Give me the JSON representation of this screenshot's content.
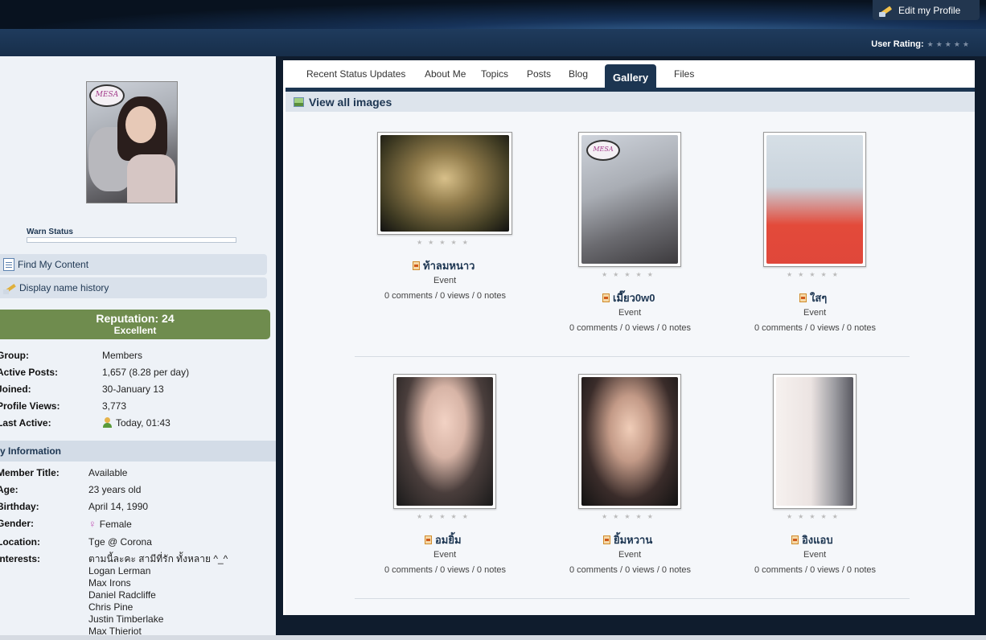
{
  "header": {
    "edit_profile_label": "Edit my Profile",
    "user_rating_label": "User Rating:",
    "rating_stars": "★★★★★"
  },
  "sidebar": {
    "avatar_tag": "MESA",
    "warn_status_label": "Warn Status",
    "links": [
      {
        "label": "Find My Content",
        "icon": "document-icon"
      },
      {
        "label": "Display name history",
        "icon": "pencil-icon"
      }
    ],
    "reputation": {
      "title": "Reputation: 24",
      "level": "Excellent"
    },
    "stats": [
      {
        "label": "Group:",
        "value": "Members"
      },
      {
        "label": "Active Posts:",
        "value": "1,657 (8.28 per day)"
      },
      {
        "label": "Joined:",
        "value": "30-January 13"
      },
      {
        "label": "Profile Views:",
        "value": "3,773"
      },
      {
        "label": "Last Active:",
        "value": "Today, 01:43"
      }
    ],
    "info_heading": "My Information",
    "info": [
      {
        "label": "Member Title:",
        "value": "Available"
      },
      {
        "label": "Age:",
        "value": "23 years old"
      },
      {
        "label": "Birthday:",
        "value": "April 14, 1990"
      },
      {
        "label": "Gender:",
        "value": "Female"
      },
      {
        "label": "Location:",
        "value": "Tge @ Corona"
      },
      {
        "label": "Interests:",
        "value": "ตามนี้ละคะ สามีที่รัก ทั้งหลาย ^_^"
      }
    ],
    "interests_list": [
      "Logan Lerman",
      "Max Irons",
      "Daniel Radcliffe",
      "Chris Pine",
      "Justin Timberlake",
      "Max Thieriot"
    ]
  },
  "tabs": [
    {
      "label": "Recent Status Updates",
      "active": false
    },
    {
      "label": "About Me",
      "active": false
    },
    {
      "label": "Topics",
      "active": false
    },
    {
      "label": "Posts",
      "active": false
    },
    {
      "label": "Blog",
      "active": false
    },
    {
      "label": "Gallery",
      "active": true
    },
    {
      "label": "Files",
      "active": false
    }
  ],
  "gallery": {
    "heading": "View all images",
    "images": [
      {
        "title": "ท้าลมหนาว",
        "category": "Event",
        "meta": "0 comments / 0 views / 0 notes",
        "stars": "★★★★★"
      },
      {
        "title": "เมี๊ยว0w0",
        "category": "Event",
        "meta": "0 comments / 0 views / 0 notes",
        "stars": "★★★★★"
      },
      {
        "title": "ใสๆ",
        "category": "Event",
        "meta": "0 comments / 0 views / 0 notes",
        "stars": "★★★★★"
      },
      {
        "title": "อมยิ้ม",
        "category": "Event",
        "meta": "0 comments / 0 views / 0 notes",
        "stars": "★★★★★"
      },
      {
        "title": "ยิ้มหวาน",
        "category": "Event",
        "meta": "0 comments / 0 views / 0 notes",
        "stars": "★★★★★"
      },
      {
        "title": "อิงแอบ",
        "category": "Event",
        "meta": "0 comments / 0 views / 0 notes",
        "stars": "★★★★★"
      }
    ]
  },
  "colors": {
    "accent": "#1c3551",
    "reputation": "#6f8c4e",
    "link": "#1d3652"
  }
}
